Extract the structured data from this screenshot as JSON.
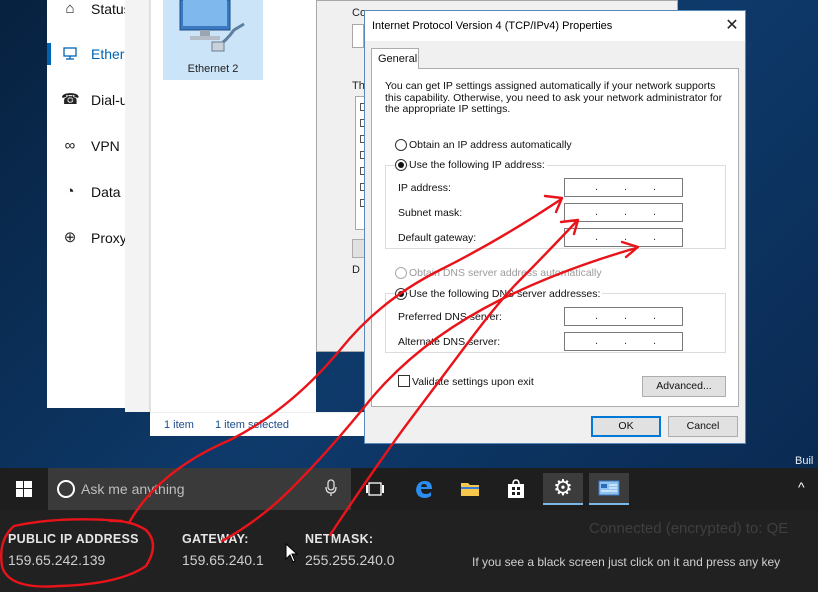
{
  "settings_nav": {
    "items": [
      {
        "label": "Status",
        "icon": "home-icon"
      },
      {
        "label": "Ethernet",
        "icon": "ethernet-icon"
      },
      {
        "label": "Dial-up",
        "icon": "dialup-icon"
      },
      {
        "label": "VPN",
        "icon": "vpn-icon"
      },
      {
        "label": "Data usage",
        "icon": "data-usage-icon"
      },
      {
        "label": "Proxy",
        "icon": "globe-icon"
      }
    ]
  },
  "network_connections": {
    "adapter_name": "Ethernet 2",
    "items_count": "1 item",
    "items_selected": "1 item selected"
  },
  "ethernet_props": {
    "connect_using": "Connect using:",
    "this_connection": "This connection uses the following items:",
    "description": "D"
  },
  "ipv4": {
    "title": "Internet Protocol Version 4 (TCP/IPv4) Properties",
    "close": "✕",
    "tab": "General",
    "intro": "You can get IP settings assigned automatically if your network supports this capability. Otherwise, you need to ask your network administrator for the appropriate IP settings.",
    "obtain_ip_auto": "Obtain an IP address automatically",
    "use_following_ip": "Use the following IP address:",
    "ip_address_label": "IP address:",
    "subnet_label": "Subnet mask:",
    "gateway_label": "Default gateway:",
    "obtain_dns_auto": "Obtain DNS server address automatically",
    "use_following_dns": "Use the following DNS server addresses:",
    "preferred_dns_label": "Preferred DNS server:",
    "alternate_dns_label": "Alternate DNS server:",
    "validate_label": "Validate settings upon exit",
    "advanced_btn": "Advanced...",
    "ok_btn": "OK",
    "cancel_btn": "Cancel",
    "ip_dots": ".   .   ."
  },
  "taskbar": {
    "search_placeholder": "Ask me anything",
    "apps": [
      "task-view-icon",
      "edge-icon",
      "file-explorer-icon",
      "store-icon",
      "settings-icon",
      "network-connections-icon"
    ]
  },
  "desktop": {
    "build_text": "Buil"
  },
  "infobar": {
    "public_ip_label": "PUBLIC IP ADDRESS",
    "public_ip_value": "159.65.242.139",
    "gateway_label": "GATEWAY:",
    "gateway_value": "159.65.240.1",
    "netmask_label": "NETMASK:",
    "netmask_value": "255.255.240.0",
    "connected_text": "Connected (encrypted) to: QE",
    "hint_text": "If you see a black screen just click on it and press any key"
  },
  "colors": {
    "accent": "#0063b1",
    "annotation": "#e8141a",
    "taskbar": "#1e1e1e"
  }
}
